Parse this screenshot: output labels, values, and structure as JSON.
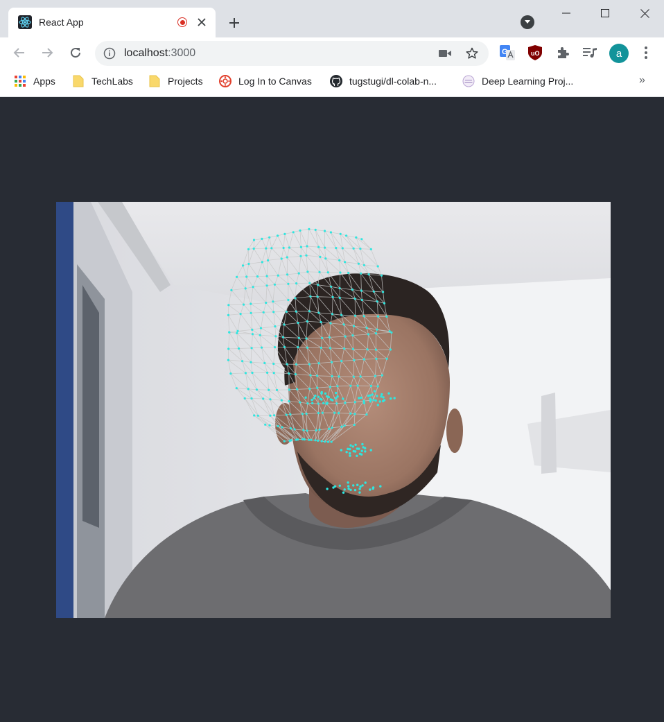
{
  "tab": {
    "title": "React App",
    "favicon": "react-icon"
  },
  "address_bar": {
    "host": "localhost",
    "port": ":3000"
  },
  "bookmarks": [
    {
      "label": "Apps",
      "icon": "apps-grid-icon"
    },
    {
      "label": "TechLabs",
      "icon": "folder-icon"
    },
    {
      "label": "Projects",
      "icon": "folder-icon"
    },
    {
      "label": "Log In to Canvas",
      "icon": "canvas-icon"
    },
    {
      "label": "tugstugi/dl-colab-n...",
      "icon": "github-icon"
    },
    {
      "label": "Deep Learning Proj...",
      "icon": "site-icon"
    }
  ],
  "bookmarks_overflow": "»",
  "profile": {
    "initial": "a",
    "color": "#12939a"
  },
  "colors": {
    "page_bg": "#282c34",
    "mesh_point": "#2ee6e0",
    "mesh_line": "#c8c8c8"
  },
  "webcam_view": {
    "content": "webcam-feed-with-face-mesh"
  }
}
